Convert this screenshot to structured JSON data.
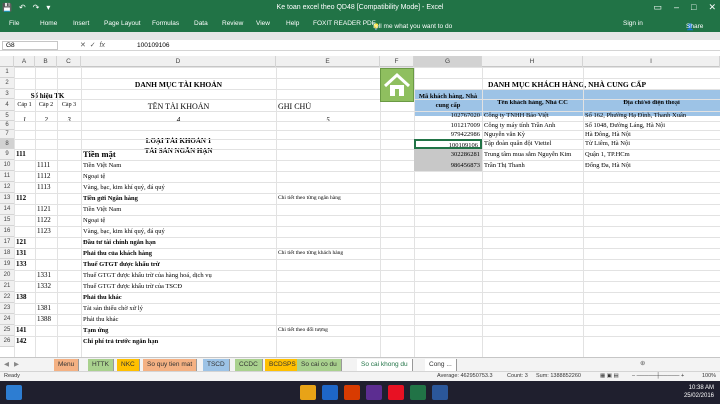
{
  "app": {
    "title": "Ke toan excel theo QD48 [Compatibility Mode] - Excel"
  },
  "ribbon": {
    "tabs": [
      "File",
      "Home",
      "Insert",
      "Page Layout",
      "Formulas",
      "Data",
      "Review",
      "View",
      "Help",
      "FOXIT READER PDF"
    ],
    "tell": "Tell me what you want to do",
    "user": "Sign in",
    "share": "Share"
  },
  "formula": {
    "namebox": "G8",
    "value": "100109106"
  },
  "columns": [
    "A",
    "B",
    "C",
    "D",
    "E",
    "F",
    "G",
    "H",
    "I"
  ],
  "rows": [
    "1",
    "2",
    "3",
    "4",
    "5",
    "6",
    "7",
    "8",
    "9",
    "10",
    "11",
    "12",
    "13",
    "14",
    "15",
    "16",
    "17",
    "18",
    "19",
    "20",
    "21",
    "22",
    "23",
    "24",
    "25",
    "26"
  ],
  "left": {
    "title": "DANH MỤC TÀI KHOẢN",
    "so_hieu": "Số hiệu TK",
    "cap1": "Cấp 1",
    "cap2": "Cấp 2",
    "cap3": "Cấp 3",
    "ten_tk": "TÊN TÀI KHOẢN",
    "ghi_chu": "GHI CHÚ",
    "n1": "1",
    "n2": "2",
    "n3": "3",
    "n4": "4",
    "n5": "5",
    "loai": "LOẠI TÀI KHOẢN 1",
    "tsnh": "TÀI SẢN NGẮN HẠN",
    "accounts": [
      {
        "c1": "111",
        "c2": "",
        "name": "Tiền mặt",
        "note": ""
      },
      {
        "c1": "",
        "c2": "1111",
        "name": "Tiền Việt Nam",
        "note": ""
      },
      {
        "c1": "",
        "c2": "1112",
        "name": "Ngoại tệ",
        "note": ""
      },
      {
        "c1": "",
        "c2": "1113",
        "name": "Vàng, bạc, kim khí quý, đá quý",
        "note": ""
      },
      {
        "c1": "112",
        "c2": "",
        "name": "Tiền gửi Ngân hàng",
        "note": "Chi tiết theo từng ngân hàng"
      },
      {
        "c1": "",
        "c2": "1121",
        "name": "Tiền Việt Nam",
        "note": ""
      },
      {
        "c1": "",
        "c2": "1122",
        "name": "Ngoại tệ",
        "note": ""
      },
      {
        "c1": "",
        "c2": "1123",
        "name": "Vàng, bạc, kim khí quý, đá quý",
        "note": ""
      },
      {
        "c1": "121",
        "c2": "",
        "name": "Đầu tư tài chính ngắn hạn",
        "note": ""
      },
      {
        "c1": "131",
        "c2": "",
        "name": "Phải thu của khách hàng",
        "note": "Chi tiết theo từng khách hàng"
      },
      {
        "c1": "133",
        "c2": "",
        "name": "Thuế GTGT được khấu trừ",
        "note": ""
      },
      {
        "c1": "",
        "c2": "1331",
        "name": "Thuế GTGT được khấu trừ của hàng hoá, dịch vụ",
        "note": ""
      },
      {
        "c1": "",
        "c2": "1332",
        "name": "Thuế GTGT được khấu trừ của TSCĐ",
        "note": ""
      },
      {
        "c1": "138",
        "c2": "",
        "name": "Phải thu khác",
        "note": ""
      },
      {
        "c1": "",
        "c2": "1381",
        "name": "Tài sản thiếu chờ xử lý",
        "note": ""
      },
      {
        "c1": "",
        "c2": "1388",
        "name": "Phải thu khác",
        "note": ""
      },
      {
        "c1": "141",
        "c2": "",
        "name": "Tạm ứng",
        "note": "Chi tiết theo đối tượng"
      },
      {
        "c1": "142",
        "c2": "",
        "name": "Chi phí trả trước ngắn hạn",
        "note": ""
      }
    ]
  },
  "right": {
    "title": "DANH MỤC KHÁCH HÀNG, NHÀ CUNG CẤP",
    "h1": "Mã khách hàng, Nhà cung cấp",
    "h2": "Tên khách hàng, Nhà CC",
    "h3": "Địa chỉ/số điện thoại",
    "customers": [
      {
        "code": "102767020",
        "name": "Công ty TNHH Bảo Việt",
        "addr": "Số 162, Phường Hạ Đình, Thanh Xuân"
      },
      {
        "code": "101217009",
        "name": "Công ty máy tính Trần Anh",
        "addr": "Số 1048, Đường Láng, Hà Nội"
      },
      {
        "code": "979422986",
        "name": "Nguyễn văn Kỳ",
        "addr": "Hà Đông, Hà Nội"
      },
      {
        "code": "100109106",
        "name": "Tập đoàn quân đội Viettel",
        "addr": "Từ Liêm, Hà Nội"
      },
      {
        "code": "302286281",
        "name": "Trung tâm mua sắm Nguyễn Kim",
        "addr": "Quận 1, TP.HCm"
      },
      {
        "code": "986456873",
        "name": "Trần Thị Thanh",
        "addr": "Đống Đa, Hà Nội"
      }
    ]
  },
  "sheets": [
    "Menu",
    "HTTK",
    "NKC",
    "So quy tien mat",
    "TSCD",
    "CCDC",
    "BCDSPS",
    "So cai co du",
    "So cai khong du",
    "Cong ..."
  ],
  "status": {
    "mode": "Ready",
    "average": "Average: 462950753.3",
    "count": "Count: 3",
    "sum": "Sum: 1388852260",
    "zoom": "100%"
  },
  "clock": {
    "time": "10:38 AM",
    "date": "25/02/2016"
  },
  "colors": {
    "excel_green": "#217346",
    "sheet_tab_colors": [
      "#f4b183",
      "#a9d18e",
      "#ffc000",
      "#f4b183",
      "#9dc3e6",
      "#a9d18e",
      "#ffc000",
      "#a9d18e",
      "#ffffff",
      "#ffffff"
    ]
  }
}
